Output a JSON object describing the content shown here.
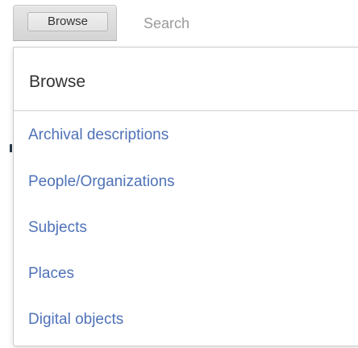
{
  "topbar": {
    "browse_button_label": "Browse",
    "search_placeholder": "Search"
  },
  "menu": {
    "title": "Browse",
    "items": [
      {
        "label": "Archival descriptions"
      },
      {
        "label": "People/Organizations"
      },
      {
        "label": "Subjects"
      },
      {
        "label": "Places"
      },
      {
        "label": "Digital objects"
      }
    ]
  },
  "colors": {
    "link": "#4f72b8",
    "heading": "#333333",
    "border": "#cccccc",
    "button_bg": "#d4d4d4"
  }
}
